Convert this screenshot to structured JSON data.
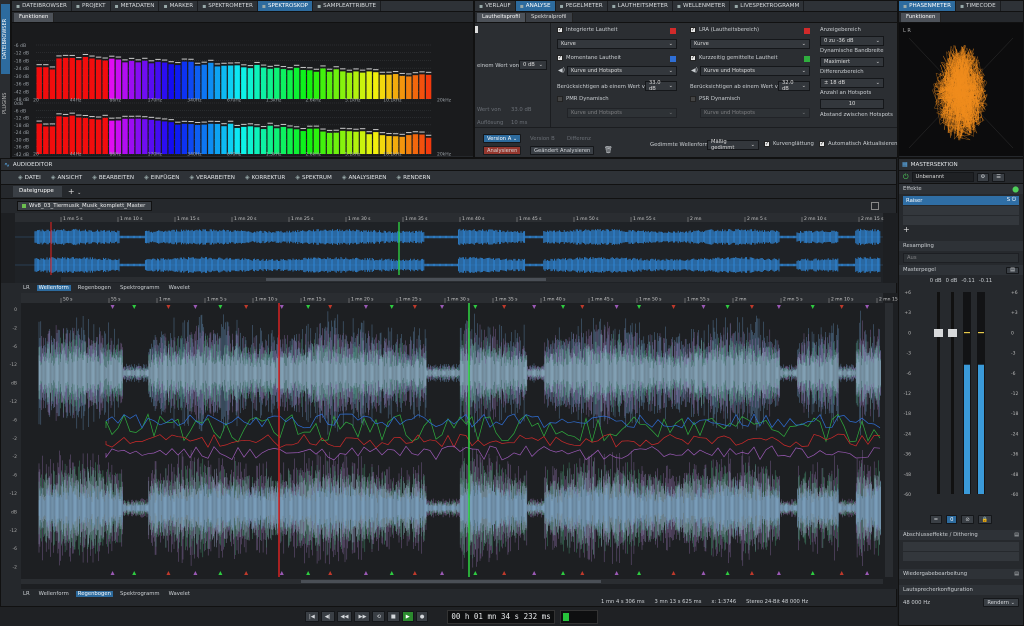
{
  "side": {
    "items": [
      "DATEIBROWSER",
      "PLUGINS"
    ]
  },
  "top_left": {
    "tabs": [
      {
        "icon": "folder-icon",
        "label": "DATEIBROWSER"
      },
      {
        "icon": "folder-icon",
        "label": "PROJEKT"
      },
      {
        "icon": "tag-icon",
        "label": "METADATEN"
      },
      {
        "icon": "marker-icon",
        "label": "MARKER"
      },
      {
        "icon": "spectrum-icon",
        "label": "SPEKTROMETER"
      },
      {
        "icon": "spectrum-icon",
        "label": "SPEKTROSKOP"
      },
      {
        "icon": "attr-icon",
        "label": "SAMPLEATTRIBUTE"
      }
    ],
    "functions_label": "Funktionen",
    "top_ylabels": [
      "-6 dB",
      "-12 dB",
      "-18 dB",
      "-24 dB",
      "-30 dB",
      "-36 dB",
      "-42 dB",
      "-48 dB"
    ],
    "bottom_ylabels": [
      "0dB",
      "-6 dB",
      "-12 dB",
      "-18 dB",
      "-24 dB",
      "-30 dB",
      "-36 dB",
      "-42 dB"
    ],
    "freq_labels": [
      "20",
      "44Hz",
      "86Hz",
      "170Hz",
      "340Hz",
      "670Hz",
      "1.3kHz",
      "2.6kHz",
      "5.1kHz",
      "10.1kHz",
      "20kHz"
    ]
  },
  "analysis": {
    "tabs": [
      {
        "icon": "history-icon",
        "label": "VERLAUF"
      },
      {
        "icon": "analysis-icon",
        "label": "ANALYSE"
      },
      {
        "icon": "meter-icon",
        "label": "PEGELMETER"
      },
      {
        "icon": "meter-icon",
        "label": "LAUTHEITSMETER"
      },
      {
        "icon": "wave-icon",
        "label": "WELLENMETER"
      },
      {
        "icon": "spectrum-icon",
        "label": "LiveSpektrogramm"
      }
    ],
    "subtabs": [
      "Lautheitsprofil",
      "Spektralprofil"
    ],
    "col0": {
      "cut_text": "einem Wert von",
      "value": "0 dB",
      "dim1": "Wert von",
      "dim1v": "33.0 dB",
      "dim2": "Auflösung",
      "dim2v": "10 ms"
    },
    "col1": {
      "check1": "Integrierte Lautheit",
      "color1": "#d12a2a",
      "sel1": "Kurve",
      "check2": "Momentane Lautheit",
      "color2": "#2f6fd6",
      "sel2": "Kurve und Hotspots",
      "thresh_label": "Berücksichtigen ab einem Wert von",
      "thresh_value": "33.0 dB",
      "check3": "PMR Dynamisch",
      "sel3": "Kurve und Hotspots"
    },
    "col2": {
      "check1": "LRA (Lautheitsbereich)",
      "color1": "#d12a2a",
      "sel1": "Kurve",
      "check2": "Kurzzeitig gemittelte Lautheit",
      "color2": "#2fae3e",
      "sel2": "Kurve und Hotspots",
      "thresh_label": "Berücksichtigen ab einem Wert von",
      "thresh_value": "32.0 dB",
      "check3": "PSR Dynamisch",
      "sel3": "Kurve und Hotspots"
    },
    "col3": {
      "label1": "Anzeigebereich",
      "sel1": "0 zu -36 dB",
      "label2": "Dynamische Bandbreite",
      "sel2": "Maximiert",
      "label3": "Differenzbereich",
      "sel3": "± 18 dB",
      "label4": "Anzahl an Hotspots",
      "sel4": "10",
      "label5": "Abstand zwischen Hotspots",
      "sel5": ""
    },
    "footer": {
      "version_a": "Version A",
      "version_b": "Version B",
      "difference": "Differenz",
      "analyze": "Analysieren",
      "analyze_changed": "Geändert Analysieren",
      "smoothed_label": "Gedimmte Wellenform",
      "smoothed_value": "Mäßig gedimmt",
      "curve_smoothing": "Kurvenglättung",
      "auto_update": "Automatisch Aktualisieren"
    }
  },
  "phase": {
    "tabs": [
      {
        "icon": "phase-icon",
        "label": "PHASENMETER"
      },
      {
        "icon": "clock-icon",
        "label": "TIMECODE"
      }
    ],
    "functions_label": "Funktionen",
    "corner": "L R",
    "accent": "#f08c1c"
  },
  "editor": {
    "title": "AUDIOEDITOR",
    "menu": [
      {
        "icon": "file-icon",
        "label": "DATEI"
      },
      {
        "icon": "eye-icon",
        "label": "ANSICHT"
      },
      {
        "icon": "edit-icon",
        "label": "BEARBEITEN"
      },
      {
        "icon": "insert-icon",
        "label": "EINFÜGEN"
      },
      {
        "icon": "process-icon",
        "label": "VERARBEITEN"
      },
      {
        "icon": "correct-icon",
        "label": "KORREKTUR"
      },
      {
        "icon": "spectrum-icon",
        "label": "SPEKTRUM"
      },
      {
        "icon": "analyze-icon",
        "label": "ANALYSIEREN"
      },
      {
        "icon": "render-icon",
        "label": "RENDERN"
      }
    ],
    "file_group": "Dateigruppe",
    "file_name": "Wv8_03_Tiermusik_Musik_komplett_Master",
    "overview_ruler": [
      "1 mn 5 s",
      "1 mn 10 s",
      "1 mn 15 s",
      "1 mn 20 s",
      "1 mn 25 s",
      "1 mn 30 s",
      "1 mn 35 s",
      "1 mn 40 s",
      "1 mn 45 s",
      "1 mn 50 s",
      "1 mn 55 s",
      "2 mn",
      "2 mn 5 s",
      "2 mn 10 s",
      "2 mn 15 s"
    ],
    "main_ruler": [
      "50 s",
      "55 s",
      "1 mn",
      "1 mn 5 s",
      "1 mn 10 s",
      "1 mn 15 s",
      "1 mn 20 s",
      "1 mn 25 s",
      "1 mn 30 s",
      "1 mn 35 s",
      "1 mn 40 s",
      "1 mn 45 s",
      "1 mn 50 s",
      "1 mn 55 s",
      "2 mn",
      "2 mn 5 s",
      "2 mn 10 s",
      "2 mn 15 s"
    ],
    "view_tabs_top": [
      "LR",
      "Wellenform",
      "Regenbogen",
      "Spektrogramm",
      "Wavelet"
    ],
    "view_tabs_bottom": [
      "LR",
      "Wellenform",
      "Regenbogen",
      "Spektrogramm",
      "Wavelet"
    ],
    "db_labels": [
      "0",
      "-2",
      "-6",
      "-12",
      "dB",
      "-12",
      "-6",
      "-2",
      "-2",
      "-6",
      "-12",
      "dB",
      "-12",
      "-6",
      "-2"
    ],
    "status": {
      "pos1": "1 mn 4 s 306 ms",
      "pos2": "3 mn 13 s 625 ms",
      "zoom": "x: 1:3746",
      "format": "Stereo 24-Bit 48 000 Hz"
    },
    "wave_color": "#2f86d6"
  },
  "transport": {
    "time": "00 h 01 mn 34 s 232 ms"
  },
  "master": {
    "title": "MASTERSEKTION",
    "preset": "Unbenannt",
    "effects_label": "Effekte",
    "plugin_name": "Raiser",
    "resampling_label": "Resampling",
    "resampling_value": "Aus",
    "level_label": "Masterpegel",
    "levels": [
      "0 dB",
      "0 dB",
      "-0.11",
      "-0.11"
    ],
    "scale_left": [
      "+6",
      "+3",
      "0",
      "-3",
      "-6",
      "-12",
      "-18",
      "-24",
      "-36",
      "-48",
      "-60"
    ],
    "scale_right": [
      "+6",
      "+3",
      "0",
      "-3",
      "-6",
      "-12",
      "-18",
      "-24",
      "-36",
      "-48",
      "-60"
    ],
    "meter_fill_left": 0.64,
    "meter_fill_right": 0.64,
    "final_label": "Abschlusseffekte / Dithering",
    "playback_label": "Wiedergabebearbeitung",
    "speaker_label": "Lautsprecherkonfiguration",
    "samplerate": "48 000 Hz",
    "render_btn": "Rendern"
  }
}
